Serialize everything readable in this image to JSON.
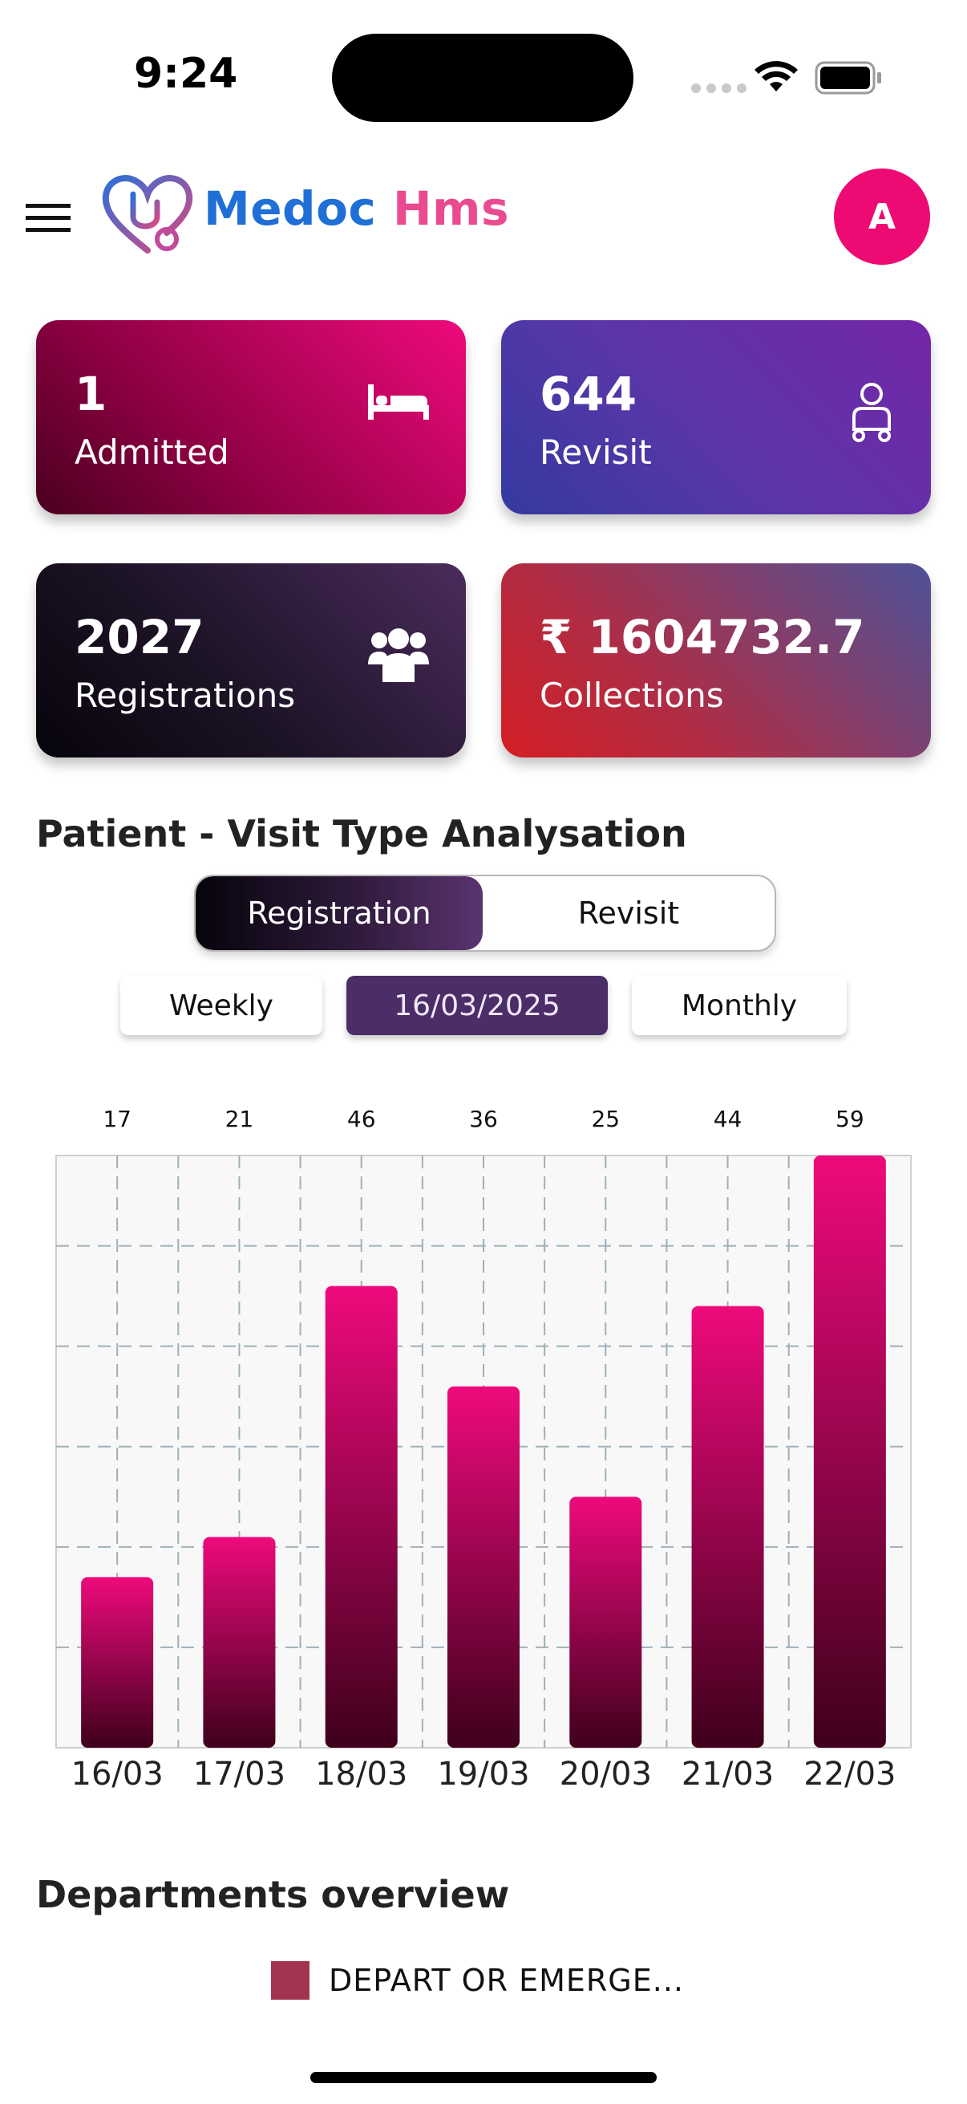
{
  "status_bar": {
    "time": "9:24"
  },
  "header": {
    "app_name_part1": "Medoc",
    "app_name_part2": "Hms",
    "avatar_initial": "A"
  },
  "cards": {
    "admitted": {
      "value": "1",
      "label": "Admitted",
      "icon": "bed-icon"
    },
    "revisit": {
      "value": "644",
      "label": "Revisit",
      "icon": "patient-icon"
    },
    "registrations": {
      "value": "2027",
      "label": "Registrations",
      "icon": "users-group-icon"
    },
    "collections": {
      "value": "₹ 1604732.7",
      "label": "Collections"
    }
  },
  "visit_analysis": {
    "title": "Patient - Visit Type Analysation",
    "toggle": {
      "active": "Registration",
      "inactive": "Revisit"
    },
    "periods": {
      "weekly": "Weekly",
      "date": "16/03/2025",
      "monthly": "Monthly"
    }
  },
  "chart_data": {
    "type": "bar",
    "categories": [
      "16/03",
      "17/03",
      "18/03",
      "19/03",
      "20/03",
      "21/03",
      "22/03"
    ],
    "values": [
      17,
      21,
      46,
      36,
      25,
      44,
      59
    ],
    "ylim": [
      0,
      59
    ],
    "grid": true,
    "bar_gradient": [
      "#ee0a7c",
      "#3f001c"
    ]
  },
  "departments": {
    "title": "Departments overview",
    "legend": [
      {
        "label": "DEPART OR EMERGE...",
        "color": "#a3344f"
      }
    ]
  },
  "colors": {
    "accent_pink": "#ee0a73",
    "brand_blue": "#1f6fd6",
    "brand_pink": "#ea4a8f"
  }
}
